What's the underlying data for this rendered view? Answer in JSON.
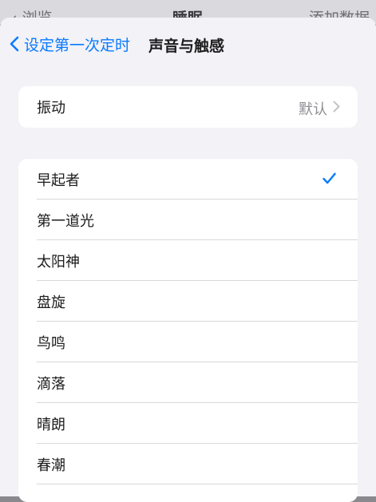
{
  "parent": {
    "back_label": "浏览",
    "title": "睡眠",
    "action_label": "添加数据"
  },
  "nav": {
    "back_label": "设定第一次定时",
    "title": "声音与触感"
  },
  "vibration": {
    "label": "振动",
    "value": "默认"
  },
  "tones": {
    "selected": "早起者",
    "items": [
      {
        "label": "早起者"
      },
      {
        "label": "第一道光"
      },
      {
        "label": "太阳神"
      },
      {
        "label": "盘旋"
      },
      {
        "label": "鸟鸣"
      },
      {
        "label": "滴落"
      },
      {
        "label": "晴朗"
      },
      {
        "label": "春潮"
      }
    ]
  },
  "colors": {
    "accent": "#0a7aff",
    "background": "#f2f2f7",
    "cell": "#ffffff",
    "separator": "#d8d8dc",
    "secondary_text": "#8e8e93"
  }
}
